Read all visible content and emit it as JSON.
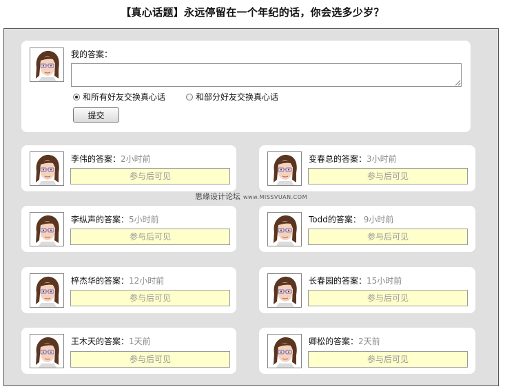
{
  "page_title": "【真心话题】永远停留在一个年纪的话，你会选多少岁？",
  "my_answer": {
    "label": "我的答案：",
    "textarea_value": "",
    "options": [
      "和所有好友交换真心话",
      "和部分好友交换真心话"
    ],
    "selected_option": 0,
    "submit_label": "提交"
  },
  "answers": [
    {
      "name": "李伟的答案：",
      "time": "2小时前",
      "hidden_text": "参与后可见"
    },
    {
      "name": "变春总的答案：",
      "time": "3小时前",
      "hidden_text": "参与后可见"
    },
    {
      "name": "李纵声的答案：",
      "time": "5小时前",
      "hidden_text": "参与后可见"
    },
    {
      "name": "Todd的答案：",
      "time": "9小时前",
      "hidden_text": "参与后可见"
    },
    {
      "name": "梓杰华的答案：",
      "time": "12小时前",
      "hidden_text": "参与后可见"
    },
    {
      "name": "长春园的答案：",
      "time": "15小时前",
      "hidden_text": "参与后可见"
    },
    {
      "name": "王木天的答案：",
      "time": "1天前",
      "hidden_text": "参与后可见"
    },
    {
      "name": "卿松的答案：",
      "time": "2天前",
      "hidden_text": "参与后可见"
    }
  ],
  "watermark": {
    "text": "思缘设计论坛",
    "url": "www.MISSVUAN.COM"
  },
  "colors": {
    "panel_bg": "#e0e0e0",
    "card_bg": "#ffffff",
    "answer_box_bg": "#ffffcc",
    "time_text": "#8a8a8a"
  }
}
